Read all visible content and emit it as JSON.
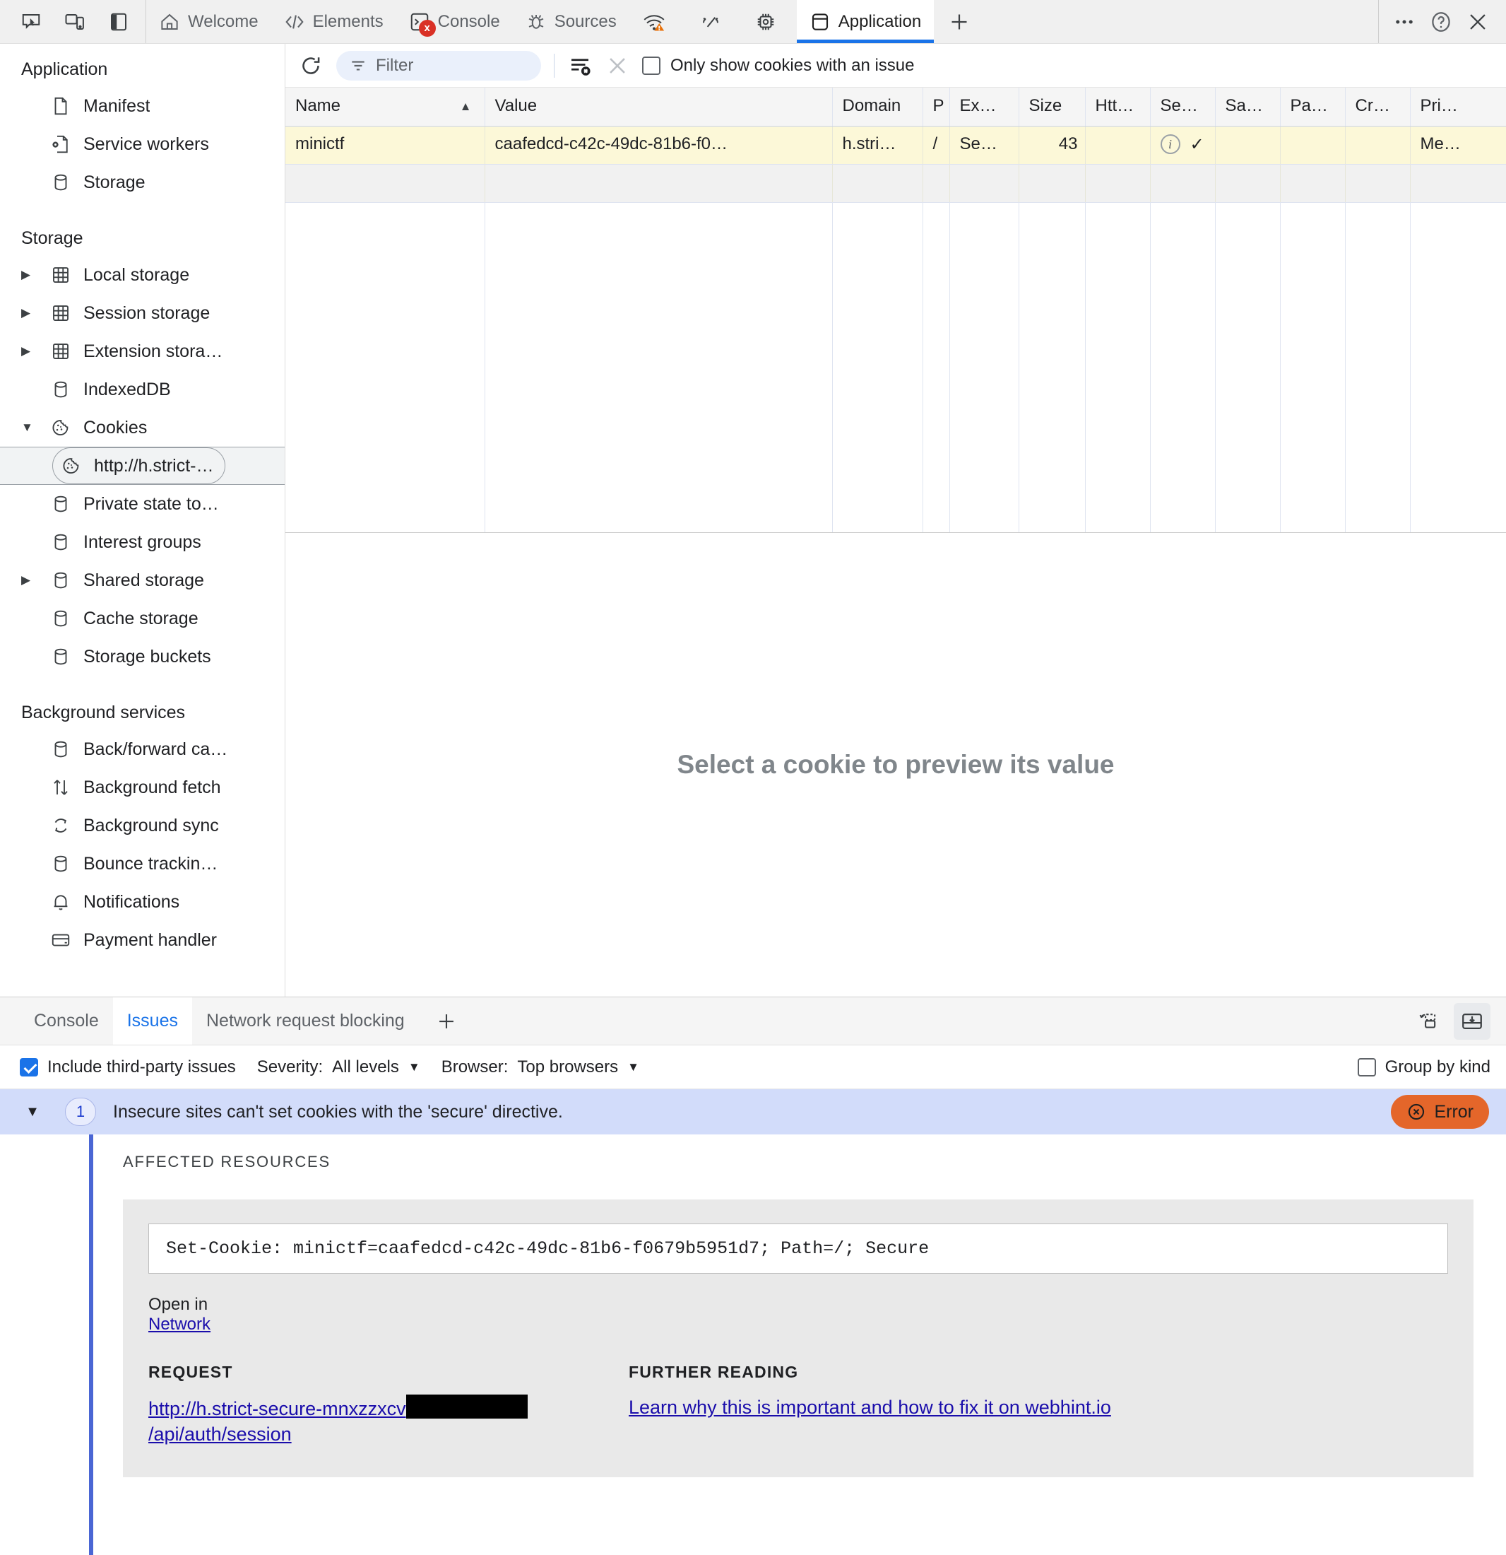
{
  "tabbar": {
    "tools": [
      "inspect-icon",
      "device-toolbar-icon",
      "panel-layout-icon"
    ],
    "tabs": [
      {
        "label": "Welcome",
        "icon": "home-icon",
        "active": false
      },
      {
        "label": "Elements",
        "icon": "code-brackets-icon",
        "active": false
      },
      {
        "label": "Console",
        "icon": "console-prompt-icon",
        "active": false,
        "badge": "x"
      },
      {
        "label": "Sources",
        "icon": "bug-icon",
        "active": false
      },
      {
        "label": "",
        "icon": "network-wifi-warning-icon",
        "active": false
      },
      {
        "label": "",
        "icon": "performance-gauge-icon",
        "active": false
      },
      {
        "label": "",
        "icon": "memory-chip-icon",
        "active": false
      },
      {
        "label": "Application",
        "icon": "application-panel-icon",
        "active": true
      }
    ],
    "add_tab": "+",
    "more_options": "⋯",
    "help": "?",
    "close": "✕"
  },
  "sidebar": {
    "sections": [
      {
        "title": "Application",
        "items": [
          {
            "label": "Manifest",
            "icon": "document-icon",
            "twisty": ""
          },
          {
            "label": "Service workers",
            "icon": "service-worker-icon",
            "twisty": ""
          },
          {
            "label": "Storage",
            "icon": "database-icon",
            "twisty": ""
          }
        ]
      },
      {
        "title": "Storage",
        "items": [
          {
            "label": "Local storage",
            "icon": "table-grid-icon",
            "twisty": "▶"
          },
          {
            "label": "Session storage",
            "icon": "table-grid-icon",
            "twisty": "▶"
          },
          {
            "label": "Extension stora…",
            "icon": "table-grid-icon",
            "twisty": "▶"
          },
          {
            "label": "IndexedDB",
            "icon": "database-icon",
            "twisty": ""
          },
          {
            "label": "Cookies",
            "icon": "cookie-icon",
            "twisty": "▼"
          },
          {
            "label": "http://h.strict-…",
            "icon": "cookie-icon",
            "twisty": "",
            "selected": true,
            "indent": true
          },
          {
            "label": "Private state to…",
            "icon": "database-icon",
            "twisty": ""
          },
          {
            "label": "Interest groups",
            "icon": "database-icon",
            "twisty": ""
          },
          {
            "label": "Shared storage",
            "icon": "database-icon",
            "twisty": "▶"
          },
          {
            "label": "Cache storage",
            "icon": "database-icon",
            "twisty": ""
          },
          {
            "label": "Storage buckets",
            "icon": "database-icon",
            "twisty": ""
          }
        ]
      },
      {
        "title": "Background services",
        "items": [
          {
            "label": "Back/forward ca…",
            "icon": "database-icon",
            "twisty": ""
          },
          {
            "label": "Background fetch",
            "icon": "up-down-arrows-icon",
            "twisty": ""
          },
          {
            "label": "Background sync",
            "icon": "sync-arrows-icon",
            "twisty": ""
          },
          {
            "label": "Bounce trackin…",
            "icon": "database-icon",
            "twisty": ""
          },
          {
            "label": "Notifications",
            "icon": "bell-icon",
            "twisty": ""
          },
          {
            "label": "Payment handler",
            "icon": "credit-card-icon",
            "twisty": ""
          }
        ]
      }
    ]
  },
  "cookie_toolbar": {
    "refresh_icon": "refresh-icon",
    "filter_placeholder": "Filter",
    "filter_value": "",
    "clear_all_icon": "clear-all-cookies-icon",
    "delete_icon": "delete-selected-cookie-icon",
    "only_issues_label": "Only show cookies with an issue",
    "only_issues_checked": false
  },
  "cookie_table": {
    "columns": [
      {
        "label": "Name",
        "sorted": true,
        "sort_arrow": "▲"
      },
      {
        "label": "Value"
      },
      {
        "label": "Domain"
      },
      {
        "label": "P"
      },
      {
        "label": "Ex…"
      },
      {
        "label": "Size"
      },
      {
        "label": "Htt…"
      },
      {
        "label": "Se…"
      },
      {
        "label": "Sa…"
      },
      {
        "label": "Pa…"
      },
      {
        "label": "Cr…"
      },
      {
        "label": "Pri…"
      }
    ],
    "rows": [
      {
        "name": "minictf",
        "value": "caafedcd-c42c-49dc-81b6-f0…",
        "domain": "h.stri…",
        "path": "/",
        "expires": "Se…",
        "size": "43",
        "httponly": "",
        "secure_info_icon": "info-circle-icon",
        "secure": "✓",
        "samesite": "",
        "partition": "",
        "cross_site": "",
        "priority": "Me…"
      }
    ]
  },
  "preview": {
    "empty_text": "Select a cookie to preview its value"
  },
  "drawer": {
    "tabs": [
      {
        "label": "Console",
        "active": false
      },
      {
        "label": "Issues",
        "active": true
      },
      {
        "label": "Network request blocking",
        "active": false
      }
    ],
    "add_tab": "+",
    "right_buttons": [
      "restore-drawer-icon",
      "dock-to-bottom-icon"
    ],
    "toolbar": {
      "include_third_party_label": "Include third-party issues",
      "include_third_party_checked": true,
      "severity_label": "Severity:",
      "severity_value": "All levels",
      "browser_label": "Browser:",
      "browser_value": "Top browsers",
      "group_by_kind_label": "Group by kind",
      "group_by_kind_checked": false,
      "caret": "▼"
    },
    "issue": {
      "twisty": "▼",
      "count": "1",
      "title": "Insecure sites can't set cookies with the 'secure' directive.",
      "badge": "Error",
      "badge_icon": "error-circle-x-icon",
      "affected_resources_heading": "AFFECTED RESOURCES",
      "code": "Set-Cookie: minictf=caafedcd-c42c-49dc-81b6-f0679b5951d7; Path=/; Secure",
      "open_in_label": "Open in",
      "open_in_link": "Network",
      "request_heading": "REQUEST",
      "request_url_part1": "http://h.strict-secure-mnxzzxcv",
      "request_url_redacted": "",
      "request_url_part2": "/api/auth/session",
      "further_reading_heading": "FURTHER READING",
      "further_reading_link": "Learn why this is important and how to fix it on webhint.io"
    }
  },
  "colors": {
    "accent": "#1a73e8",
    "error": "#e4662a",
    "link": "#1a0dab",
    "issue_header_bg": "#d2dcfa",
    "row_highlight": "#fcf8d8"
  }
}
